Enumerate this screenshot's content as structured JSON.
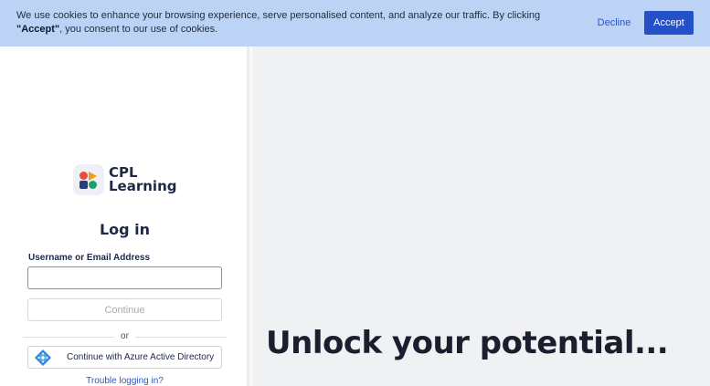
{
  "cookie_banner": {
    "text_before": "We use cookies to enhance your browsing experience, serve personalised content, and analyze our traffic. By clicking ",
    "text_bold": "\"Accept\"",
    "text_after": ", you consent to our use of cookies.",
    "decline_label": "Decline",
    "accept_label": "Accept"
  },
  "logo": {
    "line1": "CPL",
    "line2": "Learning"
  },
  "login": {
    "title": "Log in",
    "username_label": "Username or Email Address",
    "username_value": "",
    "continue_label": "Continue",
    "or_text": "or",
    "azure_label": "Continue with Azure Active Directory",
    "trouble_link": "Trouble logging in?"
  },
  "hero": {
    "headline": "Unlock your potential..."
  },
  "colors": {
    "accent": "#2451c9",
    "banner_bg": "#bcd3f5",
    "hero_bg": "#f0f1f3"
  },
  "icons": {
    "logo": "cpl-logo-icon",
    "azure": "azure-diamond-icon"
  }
}
